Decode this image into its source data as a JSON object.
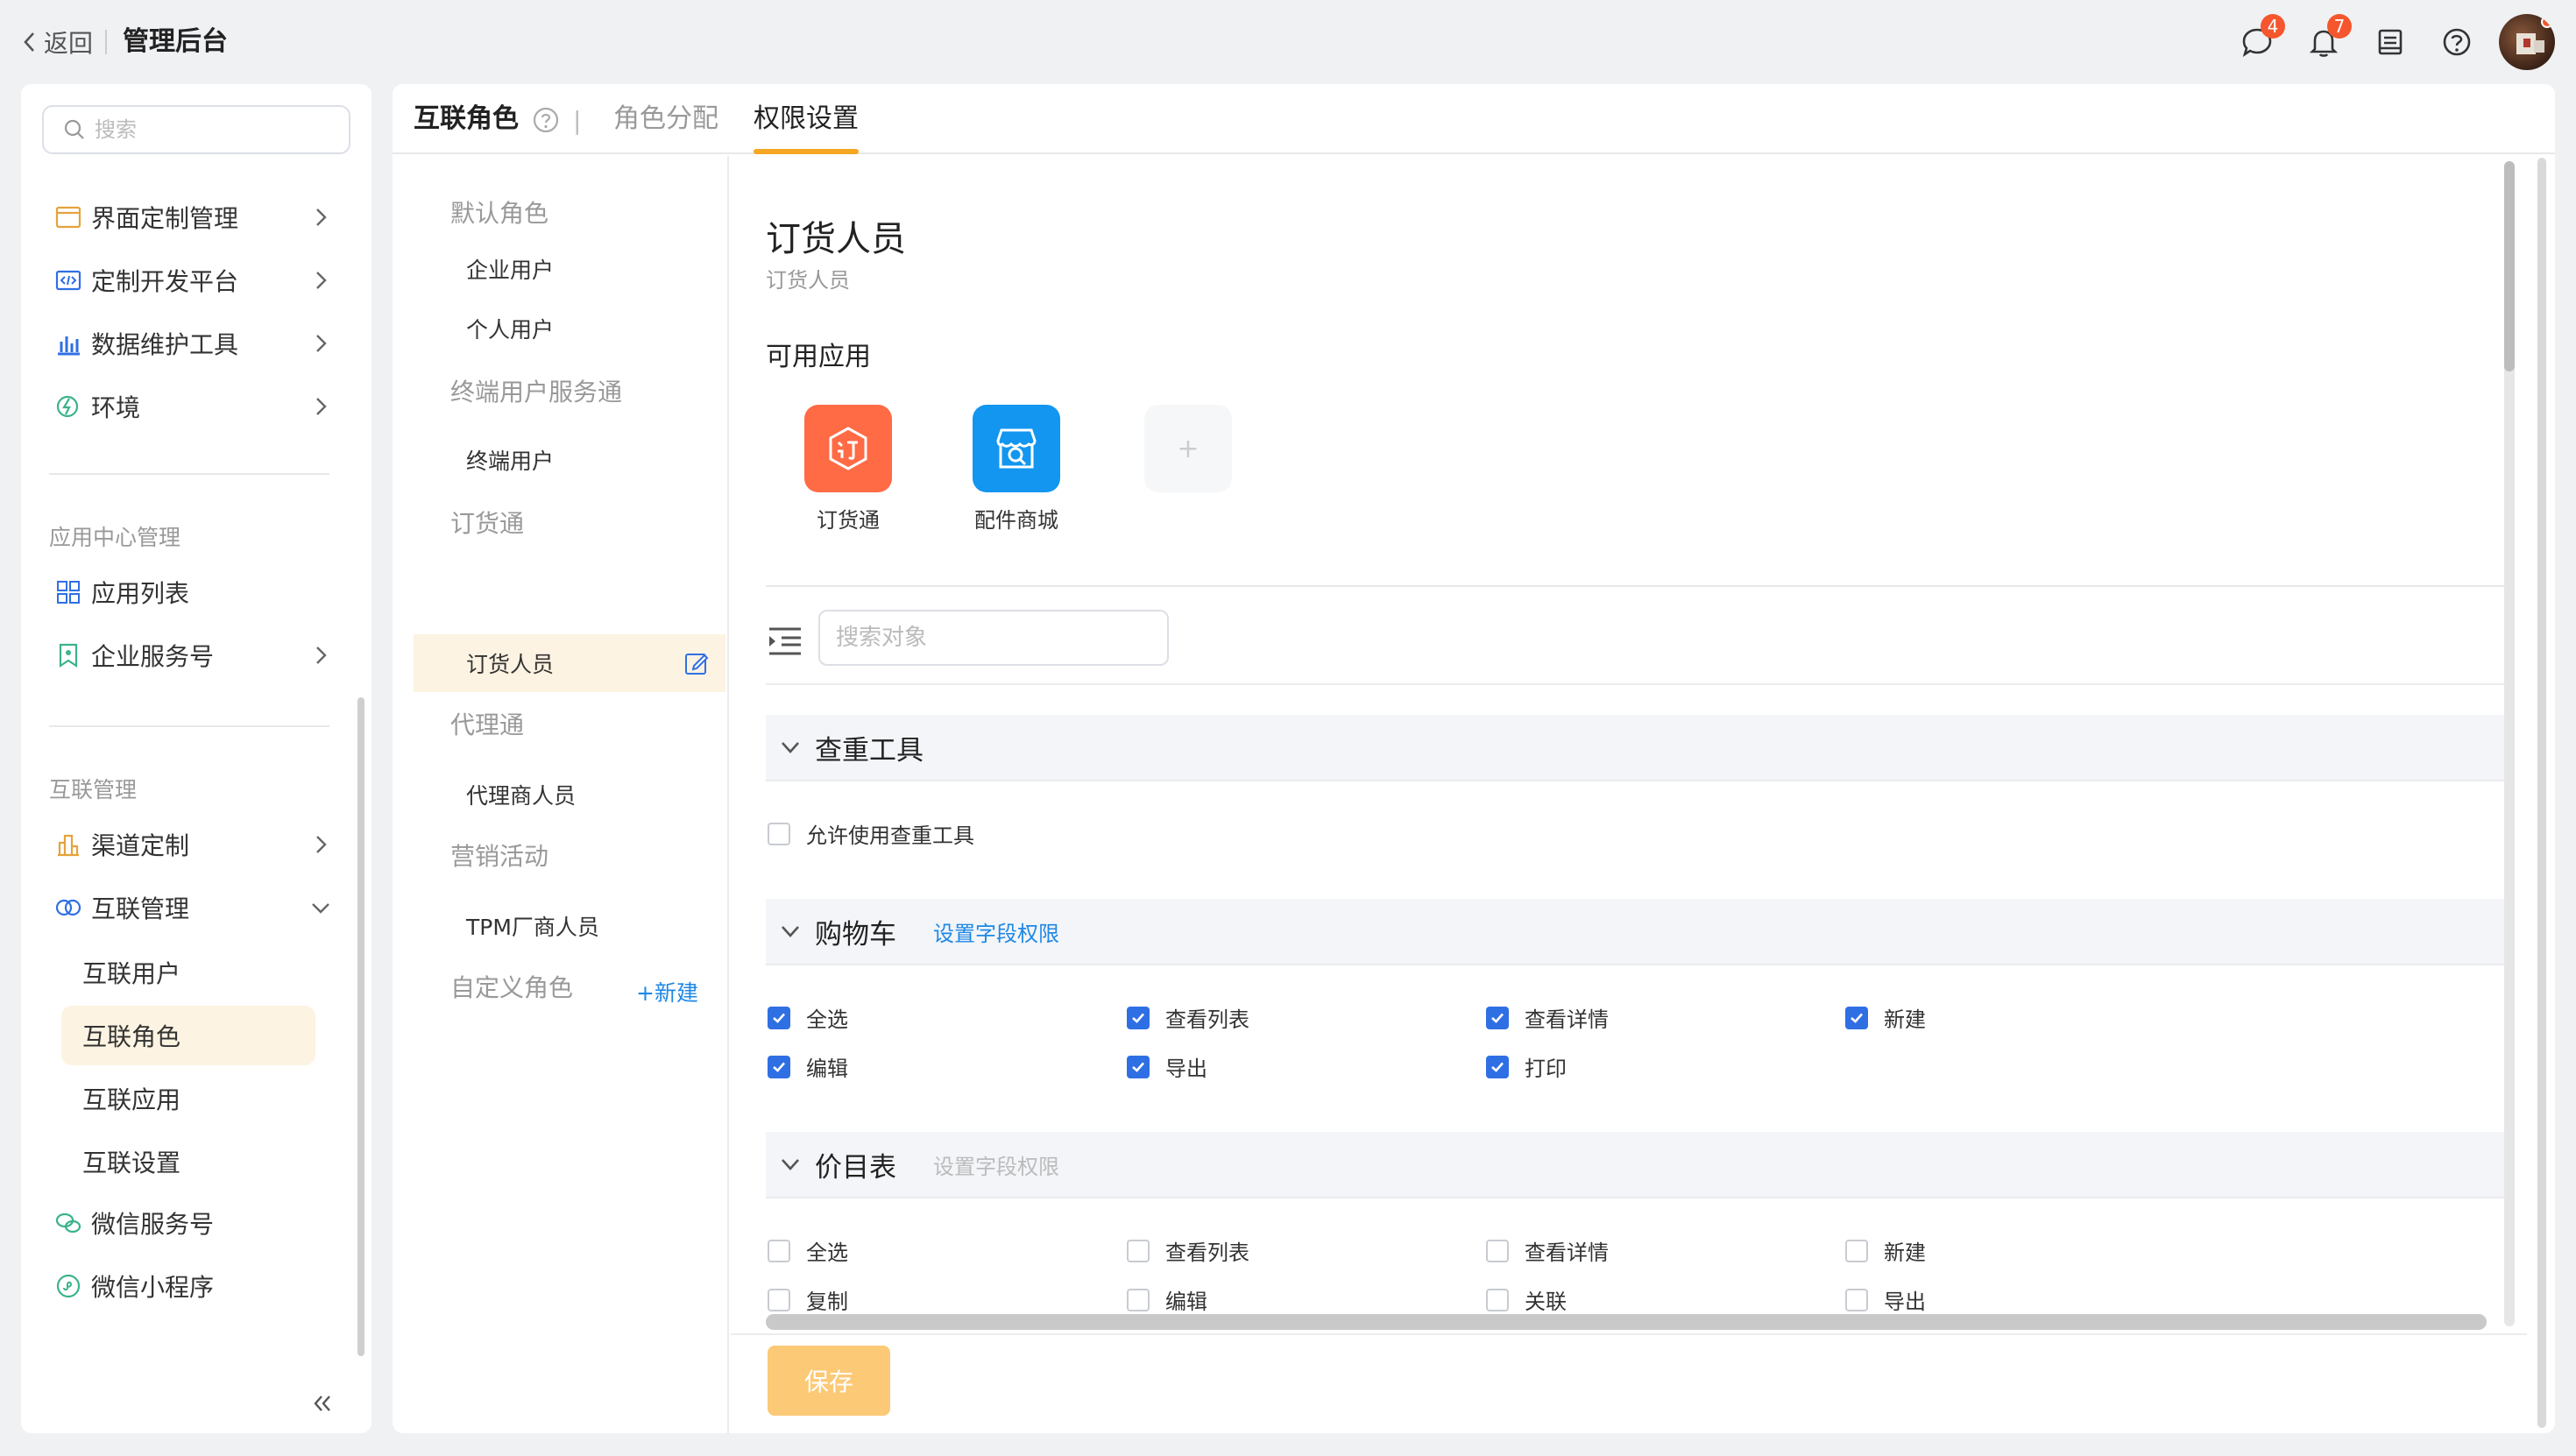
{
  "topbar": {
    "back_label": "返回",
    "app_title": "管理后台",
    "chat_badge": "4",
    "bell_badge": "7"
  },
  "sidebar": {
    "search_placeholder": "搜索",
    "items_top": [
      {
        "label": "界面定制管理",
        "icon": "layout-icon"
      },
      {
        "label": "定制开发平台",
        "icon": "code-icon"
      },
      {
        "label": "数据维护工具",
        "icon": "bar-chart-icon"
      },
      {
        "label": "环境",
        "icon": "environment-icon"
      }
    ],
    "section_app_center": "应用中心管理",
    "app_list_label": "应用列表",
    "enterprise_service_label": "企业服务号",
    "section_interconnect": "互联管理",
    "channel_label": "渠道定制",
    "interconnect_label": "互联管理",
    "sub_items": [
      "互联用户",
      "互联角色",
      "互联应用",
      "互联设置"
    ],
    "wechat_service_label": "微信服务号",
    "wechat_mini_label": "微信小程序"
  },
  "main": {
    "title": "互联角色",
    "bar": "|",
    "tabs": [
      "角色分配",
      "权限设置"
    ],
    "active_tab": "权限设置"
  },
  "roles": {
    "groups": [
      {
        "name": "默认角色",
        "items": [
          "企业用户",
          "个人用户"
        ]
      },
      {
        "name": "终端用户服务通",
        "items": [
          "终端用户"
        ]
      },
      {
        "name": "订货通",
        "items": [
          "订货人员"
        ]
      },
      {
        "name": "代理通",
        "items": [
          "代理商人员"
        ]
      },
      {
        "name": "营销活动",
        "items": [
          "TPM厂商人员"
        ]
      }
    ],
    "custom_group": "自定义角色",
    "new_label": "+新建",
    "active_role": "订货人员"
  },
  "detail": {
    "title": "订货人员",
    "subtitle": "订货人员",
    "apps_heading": "可用应用",
    "apps": [
      {
        "name": "订货通",
        "color": "#ff6b45"
      },
      {
        "name": "配件商城",
        "color": "#1296f0"
      }
    ],
    "add_app_symbol": "+",
    "object_search_placeholder": "搜索对象",
    "sections": [
      {
        "title": "查重工具",
        "link": "",
        "checkboxes": [
          {
            "label": "允许使用查重工具",
            "checked": false
          }
        ]
      },
      {
        "title": "购物车",
        "link": "设置字段权限",
        "link_enabled": true,
        "checkboxes": [
          {
            "label": "全选",
            "checked": true
          },
          {
            "label": "查看列表",
            "checked": true
          },
          {
            "label": "查看详情",
            "checked": true
          },
          {
            "label": "新建",
            "checked": true
          },
          {
            "label": "编辑",
            "checked": true
          },
          {
            "label": "导出",
            "checked": true
          },
          {
            "label": "打印",
            "checked": true
          }
        ]
      },
      {
        "title": "价目表",
        "link": "设置字段权限",
        "link_enabled": false,
        "checkboxes": [
          {
            "label": "全选",
            "checked": false
          },
          {
            "label": "查看列表",
            "checked": false
          },
          {
            "label": "查看详情",
            "checked": false
          },
          {
            "label": "新建",
            "checked": false
          },
          {
            "label": "复制",
            "checked": false
          },
          {
            "label": "编辑",
            "checked": false
          },
          {
            "label": "关联",
            "checked": false
          },
          {
            "label": "导出",
            "checked": false
          }
        ]
      }
    ],
    "save_label": "保存"
  },
  "colors": {
    "accent": "#f5a623",
    "link": "#1e88e5",
    "checkbox_checked": "#2f6fe4",
    "badge": "#f5562d"
  }
}
